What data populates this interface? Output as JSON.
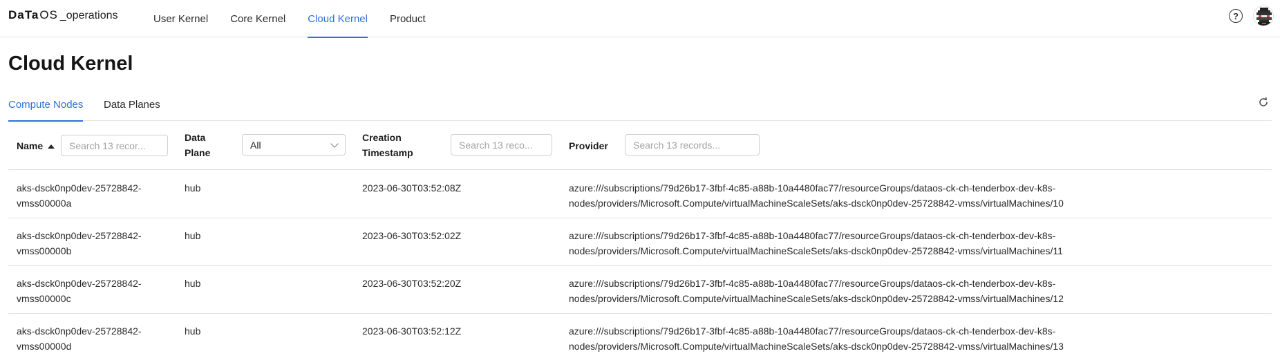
{
  "app": {
    "logo_brand": "DaTa",
    "logo_os": "OS",
    "logo_suffix": "_operations"
  },
  "nav": [
    {
      "label": "User Kernel",
      "active": false
    },
    {
      "label": "Core Kernel",
      "active": false
    },
    {
      "label": "Cloud Kernel",
      "active": true
    },
    {
      "label": "Product",
      "active": false
    }
  ],
  "page": {
    "title": "Cloud Kernel"
  },
  "tabs": [
    {
      "label": "Compute Nodes",
      "active": true
    },
    {
      "label": "Data Planes",
      "active": false
    }
  ],
  "columns": {
    "name": "Name",
    "data_plane_1": "Data",
    "data_plane_2": "Plane",
    "creation_1": "Creation",
    "creation_2": "Timestamp",
    "provider": "Provider"
  },
  "filters": {
    "name_placeholder": "Search 13 recor...",
    "data_plane_selected": "All",
    "timestamp_placeholder": "Search 13 reco...",
    "provider_placeholder": "Search 13 records..."
  },
  "rows": [
    {
      "name_1": "aks-dsck0np0dev-25728842-",
      "name_2": "vmss00000a",
      "data_plane": "hub",
      "timestamp": "2023-06-30T03:52:08Z",
      "provider_1": "azure:///subscriptions/79d26b17-3fbf-4c85-a88b-10a4480fac77/resourceGroups/dataos-ck-ch-tenderbox-dev-k8s-",
      "provider_2": "nodes/providers/Microsoft.Compute/virtualMachineScaleSets/aks-dsck0np0dev-25728842-vmss/virtualMachines/10"
    },
    {
      "name_1": "aks-dsck0np0dev-25728842-",
      "name_2": "vmss00000b",
      "data_plane": "hub",
      "timestamp": "2023-06-30T03:52:02Z",
      "provider_1": "azure:///subscriptions/79d26b17-3fbf-4c85-a88b-10a4480fac77/resourceGroups/dataos-ck-ch-tenderbox-dev-k8s-",
      "provider_2": "nodes/providers/Microsoft.Compute/virtualMachineScaleSets/aks-dsck0np0dev-25728842-vmss/virtualMachines/11"
    },
    {
      "name_1": "aks-dsck0np0dev-25728842-",
      "name_2": "vmss00000c",
      "data_plane": "hub",
      "timestamp": "2023-06-30T03:52:20Z",
      "provider_1": "azure:///subscriptions/79d26b17-3fbf-4c85-a88b-10a4480fac77/resourceGroups/dataos-ck-ch-tenderbox-dev-k8s-",
      "provider_2": "nodes/providers/Microsoft.Compute/virtualMachineScaleSets/aks-dsck0np0dev-25728842-vmss/virtualMachines/12"
    },
    {
      "name_1": "aks-dsck0np0dev-25728842-",
      "name_2": "vmss00000d",
      "data_plane": "hub",
      "timestamp": "2023-06-30T03:52:12Z",
      "provider_1": "azure:///subscriptions/79d26b17-3fbf-4c85-a88b-10a4480fac77/resourceGroups/dataos-ck-ch-tenderbox-dev-k8s-",
      "provider_2": "nodes/providers/Microsoft.Compute/virtualMachineScaleSets/aks-dsck0np0dev-25728842-vmss/virtualMachines/13"
    }
  ],
  "icons": {
    "help": "help-circle-icon",
    "refresh": "refresh-icon",
    "sort": "sort-ascending-icon",
    "chevron": "chevron-down-icon"
  },
  "colors": {
    "accent": "#2f6fd6"
  }
}
